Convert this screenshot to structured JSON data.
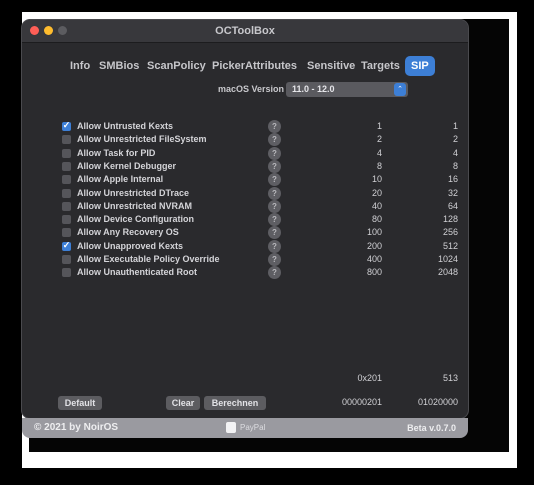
{
  "window": {
    "title": "OCToolBox"
  },
  "tabs": [
    {
      "label": "Info"
    },
    {
      "label": "SMBios"
    },
    {
      "label": "ScanPolicy"
    },
    {
      "label": "PickerAttributes"
    },
    {
      "label": "Sensitive"
    },
    {
      "label": "Targets"
    },
    {
      "label": "SIP",
      "active": true
    }
  ],
  "version": {
    "label": "macOS Version",
    "value": "11.0 - 12.0",
    "arrow_icon": "up-down-chevron-icon"
  },
  "help_glyph": "?",
  "checkmark_glyph": "✓",
  "options": [
    {
      "label": "Allow Untrusted Kexts",
      "checked": true,
      "value": "1",
      "value2": "1"
    },
    {
      "label": "Allow Unrestricted FileSystem",
      "checked": false,
      "value": "2",
      "value2": "2"
    },
    {
      "label": "Allow Task for PID",
      "checked": false,
      "value": "4",
      "value2": "4"
    },
    {
      "label": "Allow Kernel Debugger",
      "checked": false,
      "value": "8",
      "value2": "8"
    },
    {
      "label": "Allow Apple Internal",
      "checked": false,
      "value": "10",
      "value2": "16"
    },
    {
      "label": "Allow Unrestricted DTrace",
      "checked": false,
      "value": "20",
      "value2": "32"
    },
    {
      "label": "Allow Unrestricted NVRAM",
      "checked": false,
      "value": "40",
      "value2": "64"
    },
    {
      "label": "Allow Device Configuration",
      "checked": false,
      "value": "80",
      "value2": "128"
    },
    {
      "label": "Allow Any Recovery OS",
      "checked": false,
      "value": "100",
      "value2": "256"
    },
    {
      "label": "Allow Unapproved Kexts",
      "checked": true,
      "value": "200",
      "value2": "512"
    },
    {
      "label": "Allow Executable Policy Override",
      "checked": false,
      "value": "400",
      "value2": "1024"
    },
    {
      "label": "Allow Unauthenticated Root",
      "checked": false,
      "value": "800",
      "value2": "2048"
    }
  ],
  "result": {
    "hex": "0x201",
    "decimal": "513",
    "hex_padded": "00000201",
    "bytes": "01020000"
  },
  "buttons": {
    "default": "Default",
    "clear": "Clear",
    "berechnen": "Berechnen"
  },
  "footer": {
    "copyright": "© 2021 by NoirOS",
    "paypal": "PayPal",
    "version": "Beta v.0.7.0"
  },
  "colors": {
    "accent": "#3d7fd6",
    "window_bg": "#2a2a2d",
    "footer_bg": "#9a9aa0"
  }
}
